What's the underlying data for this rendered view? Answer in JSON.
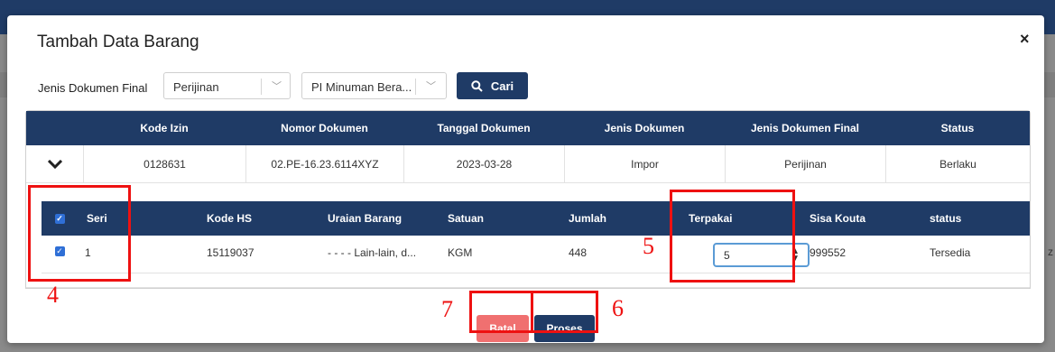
{
  "modal": {
    "title": "Tambah Data Barang",
    "close_icon": "×"
  },
  "filters": {
    "label": "Jenis Dokumen Final",
    "select1_value": "Perijinan",
    "select2_value": "PI Minuman Bera...",
    "search_label": "Cari",
    "search_icon": "search-icon"
  },
  "table1": {
    "headers": [
      "",
      "Kode Izin",
      "Nomor Dokumen",
      "Tanggal Dokumen",
      "Jenis Dokumen",
      "Jenis Dokumen Final",
      "Status"
    ],
    "row": [
      "0128631",
      "02.PE-16.23.6114XYZ",
      "2023-03-28",
      "Impor",
      "Perijinan",
      "Berlaku"
    ],
    "expand_icon": "chevron-down-icon"
  },
  "table2": {
    "headers": [
      "Seri",
      "Kode HS",
      "Uraian Barang",
      "Satuan",
      "Jumlah",
      "Terpakai",
      "Sisa Kouta",
      "status"
    ],
    "row": {
      "seri": "1",
      "kode_hs": "15119037",
      "uraian": "- - - - Lain-lain, d...",
      "satuan": "KGM",
      "jumlah": "448",
      "terpakai": "5",
      "sisa_kouta": "999552",
      "status": "Tersedia"
    },
    "header_checked": true,
    "row_checked": true
  },
  "actions": {
    "batal_label": "Batal",
    "proses_label": "Proses"
  },
  "annotations": {
    "n4": "4",
    "n5": "5",
    "n6": "6",
    "n7": "7"
  },
  "side_text": "z",
  "colors": {
    "navy": "#1f3b66",
    "batal": "#f07070",
    "annotation_red": "#e11111",
    "checkbox_blue": "#2f6fd6"
  }
}
